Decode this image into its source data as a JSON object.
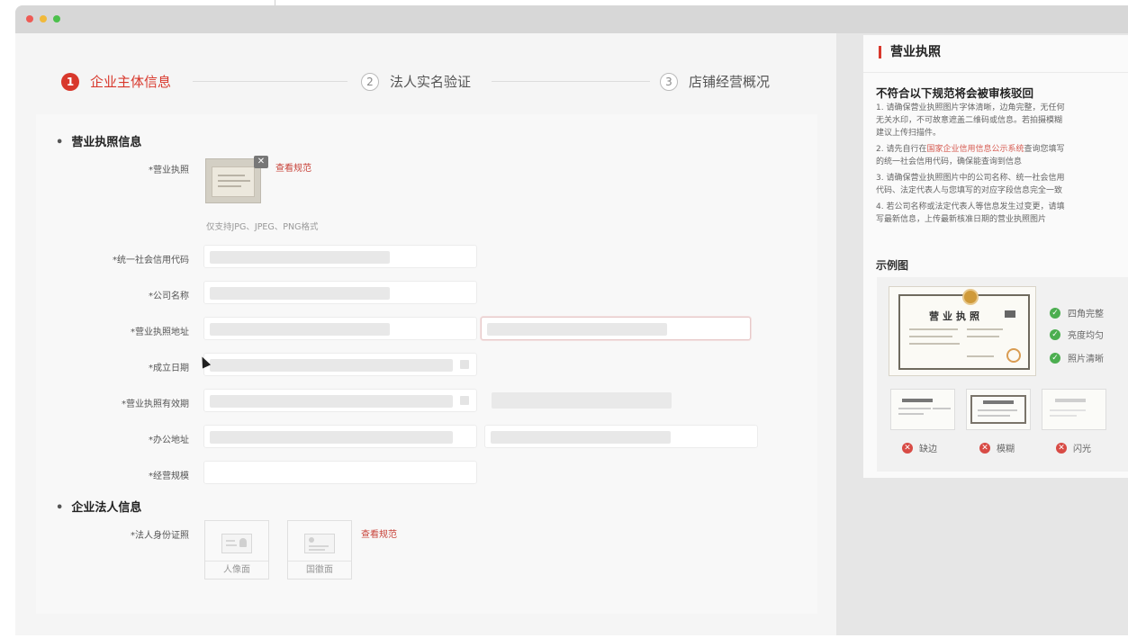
{
  "steps": [
    {
      "num": "1",
      "label": "企业主体信息"
    },
    {
      "num": "2",
      "label": "法人实名验证"
    },
    {
      "num": "3",
      "label": "店铺经营概况"
    }
  ],
  "license_section": {
    "title": "营业执照信息",
    "license_label": "*营业执照",
    "view_spec_link": "查看规范",
    "format_hint": "仅支持JPG、JPEG、PNG格式",
    "fields": [
      {
        "label": "*统一社会信用代码"
      },
      {
        "label": "*公司名称"
      },
      {
        "label": "*营业执照地址"
      },
      {
        "label": "*成立日期"
      },
      {
        "label": "*营业执照有效期"
      },
      {
        "label": "*办公地址"
      },
      {
        "label": "*经营规模"
      }
    ]
  },
  "legal_section": {
    "title": "企业法人信息",
    "id_label": "*法人身份证照",
    "front_caption": "人像面",
    "back_caption": "国徽面",
    "view_spec_link": "查看规范"
  },
  "guide": {
    "title": "营业执照",
    "subtitle": "不符合以下规范将会被审核驳回",
    "rules": [
      {
        "pre": "1. 请确保营业执照图片字体清晰，边角完整，无任何",
        "hl": "",
        "post": ""
      },
      {
        "pre": "无关水印，不可故意遮盖二维码或信息。若拍摄模糊",
        "hl": "",
        "post": ""
      },
      {
        "pre": "建议上传扫描件。",
        "hl": "",
        "post": ""
      },
      {
        "pre": "2. 请先自行在",
        "hl": "国家企业信用信息公示系统",
        "post": "查询您填写"
      },
      {
        "pre": "的统一社会信用代码，确保能查询到信息",
        "hl": "",
        "post": ""
      },
      {
        "pre": "3. 请确保营业执照图片中的公司名称、统一社会信用",
        "hl": "",
        "post": ""
      },
      {
        "pre": "代码、法定代表人与您填写的对应字段信息完全一致",
        "hl": "",
        "post": ""
      },
      {
        "pre": "4. 若公司名称或法定代表人等信息发生过变更，请填",
        "hl": "",
        "post": ""
      },
      {
        "pre": "写最新信息，上传最新核准日期的营业执照图片",
        "hl": "",
        "post": ""
      }
    ],
    "example_title": "示例图",
    "sample_license_title": "营业执照",
    "good_checks": [
      "四角完整",
      "亮度均匀",
      "照片清晰"
    ],
    "bad_examples": [
      "缺边",
      "模糊",
      "闪光"
    ],
    "colors": {
      "accent": "#d8382c",
      "ok": "#4cae50",
      "bad": "#d84b45"
    }
  }
}
